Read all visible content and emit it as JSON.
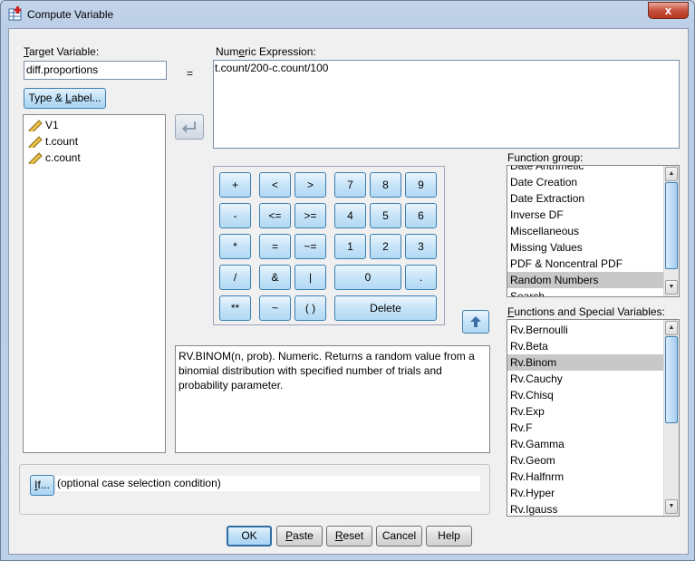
{
  "window": {
    "title": "Compute Variable",
    "close_label": "x"
  },
  "target": {
    "label_u": "T",
    "label_rest": "arget Variable:",
    "value": "diff.proportions"
  },
  "equals": "=",
  "type_label_btn": {
    "pre": "Type & ",
    "u": "L",
    "post": "abel..."
  },
  "expression": {
    "label_pre": "Num",
    "label_u": "e",
    "label_post": "ric Expression:",
    "value": "t.count/200-c.count/100"
  },
  "variables": [
    "V1",
    "t.count",
    "c.count"
  ],
  "keypad": {
    "k_plus": "+",
    "k_lt": "<",
    "k_gt": ">",
    "k7": "7",
    "k8": "8",
    "k9": "9",
    "k_minus": "-",
    "k_le": "<=",
    "k_ge": ">=",
    "k4": "4",
    "k5": "5",
    "k6": "6",
    "k_mul": "*",
    "k_eq": "=",
    "k_ne": "~=",
    "k1": "1",
    "k2": "2",
    "k3": "3",
    "k_div": "/",
    "k_and": "&",
    "k_or": "|",
    "k0": "0",
    "k_dot": ".",
    "k_pow": "**",
    "k_not": "~",
    "k_paren": "( )",
    "k_delete": "Delete"
  },
  "function_group": {
    "label": "Function group:",
    "partial_top": "Date Arithmetic",
    "items": [
      "Date Creation",
      "Date Extraction",
      "Inverse DF",
      "Miscellaneous",
      "Missing Values",
      "PDF & Noncentral PDF",
      "Random Numbers"
    ],
    "partial_bottom": "Search",
    "selected": "Random Numbers"
  },
  "functions": {
    "label_u": "F",
    "label_rest": "unctions and Special Variables:",
    "items": [
      "Rv.Bernoulli",
      "Rv.Beta",
      "Rv.Binom",
      "Rv.Cauchy",
      "Rv.Chisq",
      "Rv.Exp",
      "Rv.F",
      "Rv.Gamma",
      "Rv.Geom",
      "Rv.Halfnrm",
      "Rv.Hyper",
      "Rv.Igauss"
    ],
    "selected": "Rv.Binom"
  },
  "description": "RV.BINOM(n, prob). Numeric. Returns a random value from a binomial distribution with specified number of trials and probability parameter.",
  "if_section": {
    "btn_u": "I",
    "btn_rest": "f...",
    "condition": "(optional case selection condition)"
  },
  "footer": {
    "ok": "OK",
    "paste_u": "P",
    "paste_rest": "aste",
    "reset_u": "R",
    "reset_rest": "eset",
    "cancel": "Cancel",
    "help": "Help"
  }
}
